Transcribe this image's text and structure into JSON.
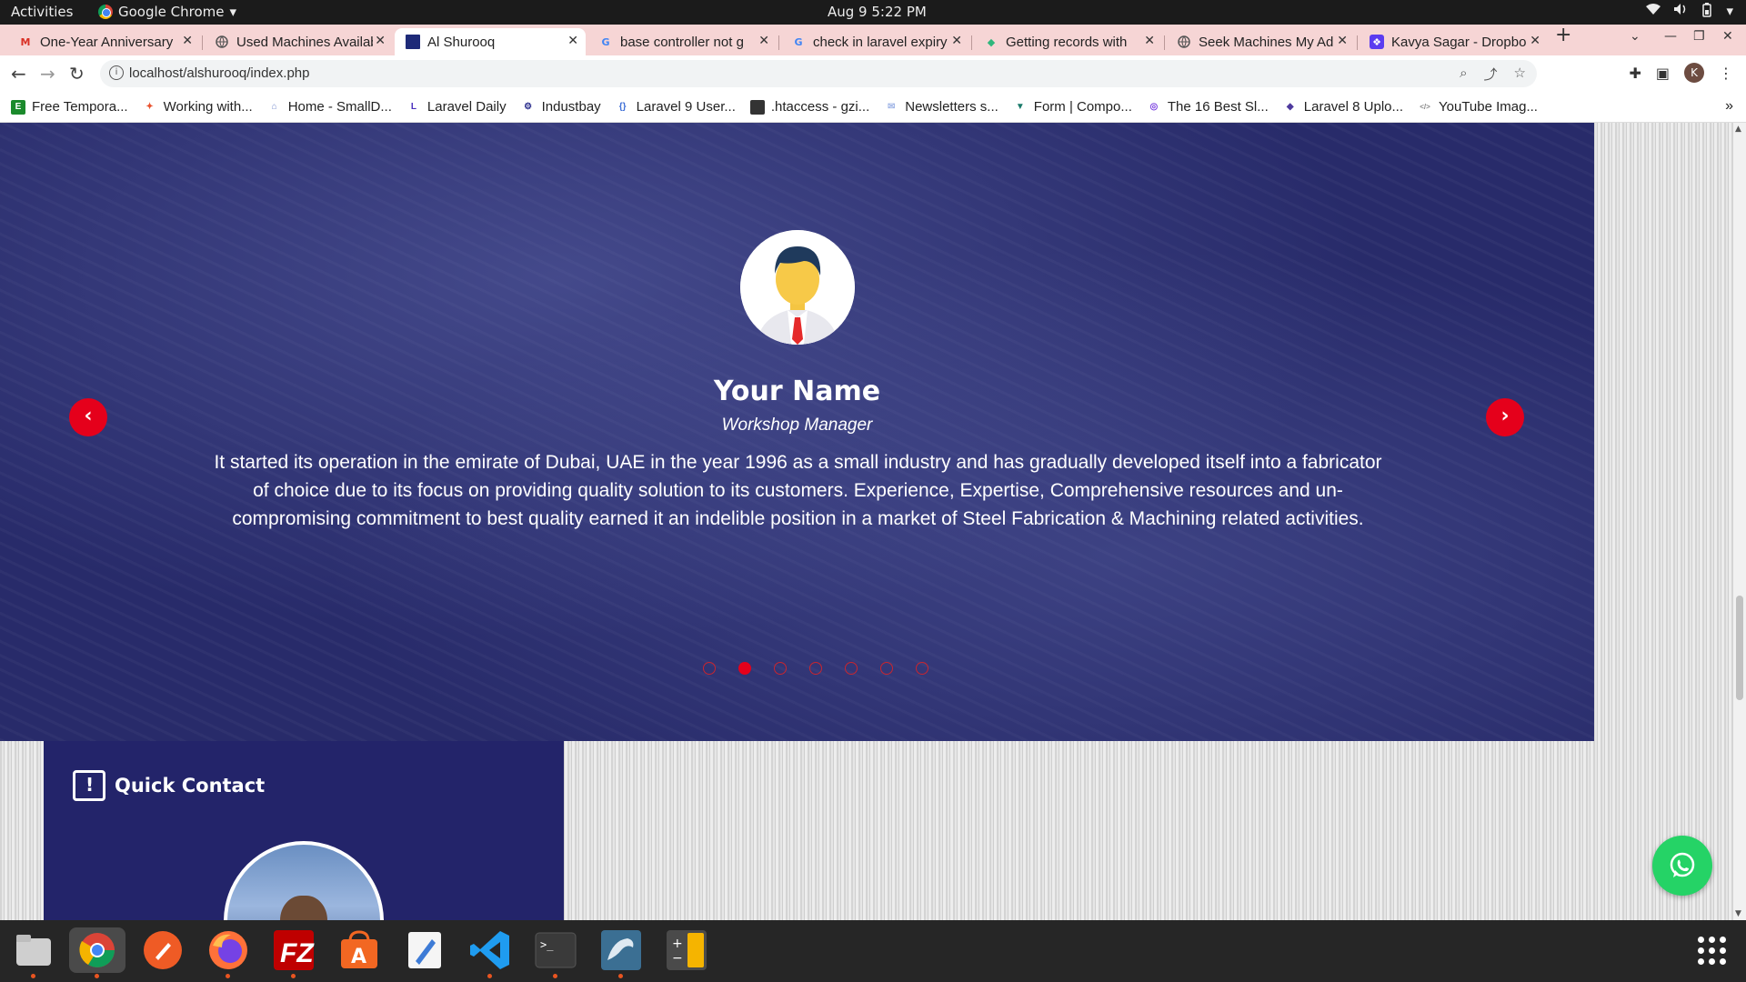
{
  "system": {
    "activities": "Activities",
    "app_name": "Google Chrome",
    "clock": "Aug 9   5:22 PM"
  },
  "tabs": [
    {
      "title": "One-Year Anniversary",
      "favicon": "gmail-icon",
      "color": "#d93025"
    },
    {
      "title": "Used Machines Available",
      "favicon": "globe-icon",
      "color": "#666666"
    },
    {
      "title": "Al Shurooq",
      "favicon": "site-icon",
      "color": "#1e2a78",
      "active": true
    },
    {
      "title": "base controller not g",
      "favicon": "google-icon",
      "color": "#4285f4"
    },
    {
      "title": "check in laravel expiry",
      "favicon": "google-icon",
      "color": "#4285f4"
    },
    {
      "title": "Getting records with",
      "favicon": "laracasts-icon",
      "color": "#2fb67c"
    },
    {
      "title": "Seek Machines My Ad",
      "favicon": "globe-icon",
      "color": "#666666"
    },
    {
      "title": "Kavya Sagar - Dropbo",
      "favicon": "dropbox-icon",
      "color": "#5b3cf0"
    }
  ],
  "address": {
    "url": "localhost/alshurooq/index.php"
  },
  "bookmarks": [
    {
      "label": "Free Tempora...",
      "color": "#1b8a2c",
      "glyph": "E"
    },
    {
      "label": "Working with...",
      "color": "#e9532f",
      "glyph": "✦"
    },
    {
      "label": "Home - SmallD...",
      "color": "#7a8fd0",
      "glyph": "⌂"
    },
    {
      "label": "Laravel Daily",
      "color": "#4a2fbd",
      "glyph": "L"
    },
    {
      "label": "Industbay",
      "color": "#2a2d8c",
      "glyph": "⚙"
    },
    {
      "label": "Laravel 9 User...",
      "color": "#3e6fd6",
      "glyph": "{}"
    },
    {
      "label": ".htaccess - gzi...",
      "color": "#333333",
      "glyph": "▮"
    },
    {
      "label": "Newsletters s...",
      "color": "#9fb4e6",
      "glyph": "✉"
    },
    {
      "label": "Form | Compo...",
      "color": "#1a7a6a",
      "glyph": "▼"
    },
    {
      "label": "The 16 Best Sl...",
      "color": "#7a3fe0",
      "glyph": "◎"
    },
    {
      "label": "Laravel 8 Uplo...",
      "color": "#4e3a9e",
      "glyph": "◆"
    },
    {
      "label": "YouTube Imag...",
      "color": "#888888",
      "glyph": "</>"
    }
  ],
  "testimonial": {
    "name": "Your Name",
    "role": "Workshop Manager",
    "quote": "It started its operation in the emirate of Dubai, UAE in the year 1996 as a small industry and has gradually developed itself into a fabricator of choice due to its focus on providing quality solution to its customers. Experience, Expertise, Comprehensive resources and un-compromising commitment to best quality earned it an indelible position in a market of Steel Fabrication & Machining related activities.",
    "prev_arrow": "‹",
    "next_arrow": "›",
    "slide_count": 7,
    "active_slide": 2
  },
  "quick_contact": {
    "heading": "Quick Contact"
  },
  "colors": {
    "accent_red": "#e5001b",
    "section_navy": "#282b6a",
    "whatsapp_green": "#25d366"
  },
  "dock": [
    "files-icon",
    "chrome-icon",
    "postman-icon",
    "firefox-icon",
    "filezilla-icon",
    "software-center-icon",
    "text-editor-icon",
    "vscode-icon",
    "terminal-icon",
    "mysql-workbench-icon",
    "calculator-icon"
  ]
}
